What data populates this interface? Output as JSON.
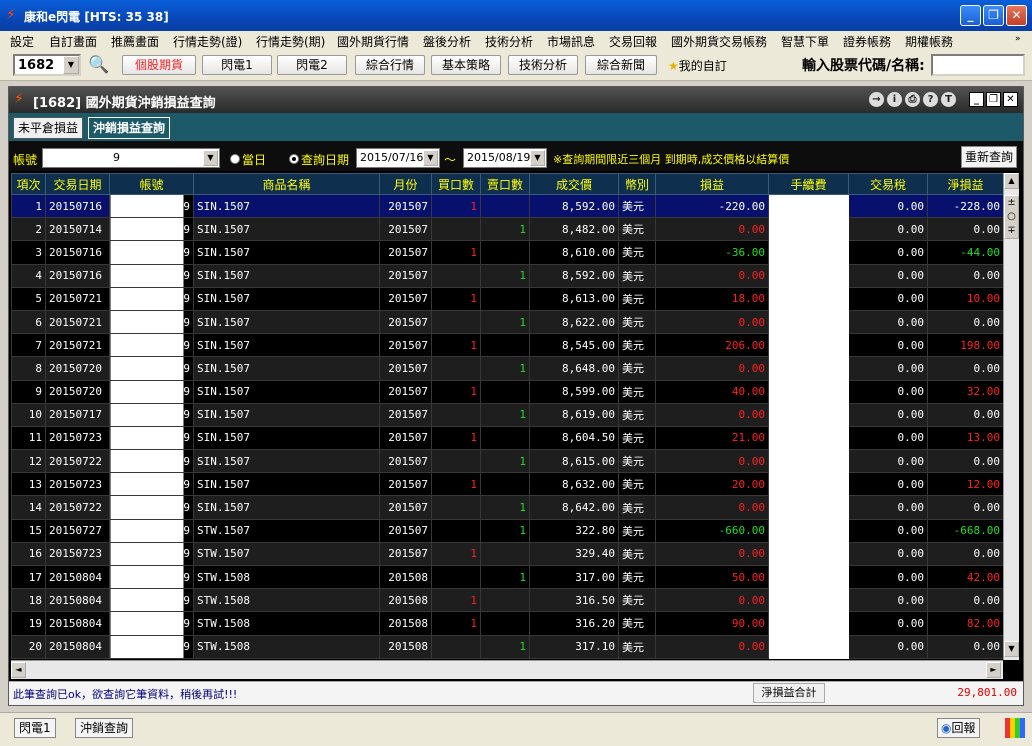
{
  "window": {
    "title": "康和e閃電 [HTS: 35 38]"
  },
  "menu": [
    "設定",
    "自訂畫面",
    "推薦畫面",
    "行情走勢(證)",
    "行情走勢(期)",
    "國外期貨行情",
    "盤後分析",
    "技術分析",
    "市場訊息",
    "交易回報",
    "國外期貨交易帳務",
    "智慧下單",
    "證券帳務",
    "期權帳務"
  ],
  "toolbar": {
    "stock_code": "1682",
    "buttons": [
      "個股期貨",
      "閃電1",
      "閃電2",
      "綜合行情",
      "基本策略",
      "技術分析",
      "綜合新聞"
    ],
    "favorite": "我的自訂",
    "stock_input_label": "輸入股票代碼/名稱:"
  },
  "inner": {
    "title": "[1682] 國外期貨沖銷損益查詢"
  },
  "tabs": [
    "未平倉損益",
    "沖銷損益查詢"
  ],
  "filter": {
    "account_label": "帳號",
    "account_value": "9",
    "radio_today": "當日",
    "radio_date": "查詢日期",
    "date_from": "2015/07/16",
    "tilde": "～",
    "date_to": "2015/08/19",
    "note": "※查詢期間限近三個月 到期時,成交價格以結算價",
    "requery": "重新查詢"
  },
  "table": {
    "headers": [
      "項次",
      "交易日期",
      "帳號",
      "商品名稱",
      "月份",
      "買口數",
      "賣口數",
      "成交價",
      "幣別",
      "損益",
      "手續費",
      "交易稅",
      "淨損益"
    ],
    "rows": [
      [
        "1",
        "20150716",
        "9",
        "SIN.1507",
        "201507",
        "1",
        "",
        "8,592.00",
        "美元",
        "-220.00",
        "",
        "0.00",
        "-228.00"
      ],
      [
        "2",
        "20150714",
        "9",
        "SIN.1507",
        "201507",
        "",
        "1",
        "8,482.00",
        "美元",
        "0.00",
        "",
        "0.00",
        "0.00"
      ],
      [
        "3",
        "20150716",
        "9",
        "SIN.1507",
        "201507",
        "1",
        "",
        "8,610.00",
        "美元",
        "-36.00",
        "",
        "0.00",
        "-44.00"
      ],
      [
        "4",
        "20150716",
        "9",
        "SIN.1507",
        "201507",
        "",
        "1",
        "8,592.00",
        "美元",
        "0.00",
        "",
        "0.00",
        "0.00"
      ],
      [
        "5",
        "20150721",
        "9",
        "SIN.1507",
        "201507",
        "1",
        "",
        "8,613.00",
        "美元",
        "18.00",
        "",
        "0.00",
        "10.00"
      ],
      [
        "6",
        "20150721",
        "9",
        "SIN.1507",
        "201507",
        "",
        "1",
        "8,622.00",
        "美元",
        "0.00",
        "",
        "0.00",
        "0.00"
      ],
      [
        "7",
        "20150721",
        "9",
        "SIN.1507",
        "201507",
        "1",
        "",
        "8,545.00",
        "美元",
        "206.00",
        "",
        "0.00",
        "198.00"
      ],
      [
        "8",
        "20150720",
        "9",
        "SIN.1507",
        "201507",
        "",
        "1",
        "8,648.00",
        "美元",
        "0.00",
        "",
        "0.00",
        "0.00"
      ],
      [
        "9",
        "20150720",
        "9",
        "SIN.1507",
        "201507",
        "1",
        "",
        "8,599.00",
        "美元",
        "40.00",
        "",
        "0.00",
        "32.00"
      ],
      [
        "10",
        "20150717",
        "9",
        "SIN.1507",
        "201507",
        "",
        "1",
        "8,619.00",
        "美元",
        "0.00",
        "",
        "0.00",
        "0.00"
      ],
      [
        "11",
        "20150723",
        "9",
        "SIN.1507",
        "201507",
        "1",
        "",
        "8,604.50",
        "美元",
        "21.00",
        "",
        "0.00",
        "13.00"
      ],
      [
        "12",
        "20150722",
        "9",
        "SIN.1507",
        "201507",
        "",
        "1",
        "8,615.00",
        "美元",
        "0.00",
        "",
        "0.00",
        "0.00"
      ],
      [
        "13",
        "20150723",
        "9",
        "SIN.1507",
        "201507",
        "1",
        "",
        "8,632.00",
        "美元",
        "20.00",
        "",
        "0.00",
        "12.00"
      ],
      [
        "14",
        "20150722",
        "9",
        "SIN.1507",
        "201507",
        "",
        "1",
        "8,642.00",
        "美元",
        "0.00",
        "",
        "0.00",
        "0.00"
      ],
      [
        "15",
        "20150727",
        "9",
        "STW.1507",
        "201507",
        "",
        "1",
        "322.80",
        "美元",
        "-660.00",
        "",
        "0.00",
        "-668.00"
      ],
      [
        "16",
        "20150723",
        "9",
        "STW.1507",
        "201507",
        "1",
        "",
        "329.40",
        "美元",
        "0.00",
        "",
        "0.00",
        "0.00"
      ],
      [
        "17",
        "20150804",
        "9",
        "STW.1508",
        "201508",
        "",
        "1",
        "317.00",
        "美元",
        "50.00",
        "",
        "0.00",
        "42.00"
      ],
      [
        "18",
        "20150804",
        "9",
        "STW.1508",
        "201508",
        "1",
        "",
        "316.50",
        "美元",
        "0.00",
        "",
        "0.00",
        "0.00"
      ],
      [
        "19",
        "20150804",
        "9",
        "STW.1508",
        "201508",
        "1",
        "",
        "316.20",
        "美元",
        "90.00",
        "",
        "0.00",
        "82.00"
      ],
      [
        "20",
        "20150804",
        "9",
        "STW.1508",
        "201508",
        "",
        "1",
        "317.10",
        "美元",
        "0.00",
        "",
        "0.00",
        "0.00"
      ]
    ]
  },
  "status": {
    "message": "此筆查詢已ok，欲查詢它筆資料，稍後再試!!!",
    "net_total_label": "淨損益合計",
    "net_total_value": "29,801.00"
  },
  "taskbar": {
    "items": [
      "閃電1",
      "沖銷查詢"
    ],
    "report": "回報"
  },
  "colors": {
    "loss": "#ff2020",
    "gain_green": "#22dd22",
    "header_text": "#ffff00",
    "selected_row": "#08106e"
  }
}
